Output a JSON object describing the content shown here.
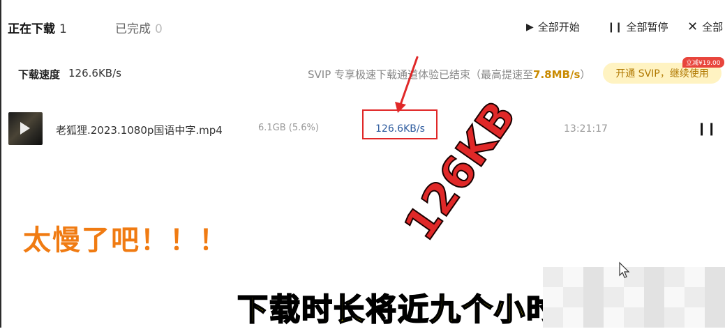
{
  "tabs": {
    "downloading": {
      "label": "正在下载",
      "count": "1"
    },
    "completed": {
      "label": "已完成",
      "count": "0"
    }
  },
  "toolbar": {
    "start_all": "全部开始",
    "pause_all": "全部暂停",
    "cancel_all": "全部"
  },
  "speed": {
    "label": "下载速度",
    "value": "126.6KB/s"
  },
  "svip": {
    "notice_prefix": "SVIP 专享极速下载通道体验已结束（最高提速至",
    "notice_speed": "7.8MB/s",
    "notice_suffix": "）",
    "button": "开通 SVIP，继续使用",
    "price_badge": "立减¥19.00"
  },
  "file": {
    "name": "老狐狸.2023.1080p国语中字.mp4",
    "size": "6.1GB (5.6%)",
    "speed": "126.6KB/s",
    "remaining_time": "13:21:17"
  },
  "annotations": {
    "big_red": "126KB",
    "orange": "太慢了吧！！！",
    "subtitle": "下载时长将近九个小时"
  },
  "colors": {
    "highlight_red": "#e02828",
    "orange": "#f07b12",
    "subtitle_yellow": "#ffee00",
    "svip_gold": "#c98a00"
  }
}
